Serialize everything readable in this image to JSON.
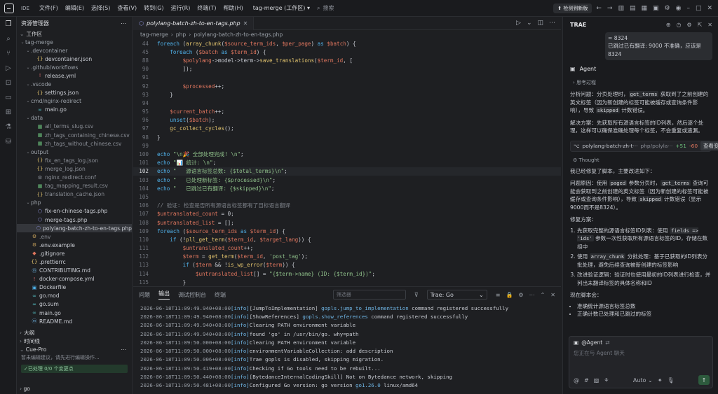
{
  "titlebar": {
    "ide_badge": "IDE",
    "menus": [
      "文件(F)",
      "编辑(E)",
      "选择(S)",
      "查看(V)",
      "转到(G)",
      "运行(R)",
      "终端(T)",
      "帮助(H)"
    ],
    "workspace": "tag-merge (工作区)",
    "search_placeholder": "搜索",
    "new_version": "检测到新版"
  },
  "explorer": {
    "title": "资源管理器",
    "section": "工作区",
    "tree": [
      {
        "label": "tag-merge",
        "depth": 0,
        "type": "folder",
        "open": true
      },
      {
        "label": ".devcontainer",
        "depth": 1,
        "type": "folder",
        "open": true
      },
      {
        "label": "devcontainer.json",
        "depth": 2,
        "type": "json"
      },
      {
        "label": ".github/workflows",
        "depth": 1,
        "type": "folder",
        "open": true
      },
      {
        "label": "release.yml",
        "depth": 2,
        "type": "yml"
      },
      {
        "label": ".vscode",
        "depth": 1,
        "type": "folder",
        "open": true
      },
      {
        "label": "settings.json",
        "depth": 2,
        "type": "json"
      },
      {
        "label": "cmd/nginx-redirect",
        "depth": 1,
        "type": "folder",
        "open": true
      },
      {
        "label": "main.go",
        "depth": 2,
        "type": "go"
      },
      {
        "label": "data",
        "depth": 1,
        "type": "folder",
        "open": true
      },
      {
        "label": "all_terms_slug.csv",
        "depth": 2,
        "type": "csv",
        "dim": true
      },
      {
        "label": "zh_tags_containing_chinese.csv",
        "depth": 2,
        "type": "csv",
        "dim": true
      },
      {
        "label": "zh_tags_without_chinese.csv",
        "depth": 2,
        "type": "csv",
        "dim": true
      },
      {
        "label": "output",
        "depth": 1,
        "type": "folder",
        "open": true
      },
      {
        "label": "fix_en_tags_log.json",
        "depth": 2,
        "type": "json",
        "dim": true
      },
      {
        "label": "merge_log.json",
        "depth": 2,
        "type": "json",
        "dim": true
      },
      {
        "label": "nginx_redirect.conf",
        "depth": 2,
        "type": "conf",
        "dim": true
      },
      {
        "label": "tag_mapping_result.csv",
        "depth": 2,
        "type": "csv",
        "dim": true
      },
      {
        "label": "translation_cache.json",
        "depth": 2,
        "type": "json",
        "dim": true
      },
      {
        "label": "php",
        "depth": 1,
        "type": "folder",
        "open": true
      },
      {
        "label": "fix-en-chinese-tags.php",
        "depth": 2,
        "type": "php"
      },
      {
        "label": "merge-tags.php",
        "depth": 2,
        "type": "php"
      },
      {
        "label": "polylang-batch-zh-to-en-tags.php",
        "depth": 2,
        "type": "php",
        "selected": true
      },
      {
        "label": ".env",
        "depth": 1,
        "type": "env",
        "dim": true
      },
      {
        "label": ".env.example",
        "depth": 1,
        "type": "env"
      },
      {
        "label": ".gitignore",
        "depth": 1,
        "type": "git"
      },
      {
        "label": ".prettierrc",
        "depth": 1,
        "type": "json"
      },
      {
        "label": "CONTRIBUTING.md",
        "depth": 1,
        "type": "md"
      },
      {
        "label": "docker-compose.yml",
        "depth": 1,
        "type": "yml"
      },
      {
        "label": "Dockerfile",
        "depth": 1,
        "type": "docker"
      },
      {
        "label": "go.mod",
        "depth": 1,
        "type": "go"
      },
      {
        "label": "go.sum",
        "depth": 1,
        "type": "go"
      },
      {
        "label": "main.go",
        "depth": 1,
        "type": "go"
      },
      {
        "label": "README.md",
        "depth": 1,
        "type": "md"
      }
    ],
    "outline": "大纲",
    "timeline": "时间线",
    "cue_title": "Cue-Pro",
    "cue_hint": "暂未编辑建议，请先进行编辑操作...",
    "cue_status": "已处理 0/0 个变更点",
    "go_section": "go"
  },
  "editor": {
    "tab_label": "polylang-batch-zh-to-en-tags.php",
    "breadcrumb": [
      "tag-merge",
      "php",
      "polylang-batch-zh-to-en-tags.php"
    ],
    "current_line": 102,
    "lines": [
      {
        "n": 44,
        "code": "foreach (array_chunk($source_term_ids, $per_page) as $batch) {"
      },
      {
        "n": 45,
        "code": "    foreach ($batch as $term_id) {"
      },
      {
        "n": 88,
        "code": "        $polylang->model->term->save_translations($term_id, ["
      },
      {
        "n": 90,
        "code": "        ]);"
      },
      {
        "n": 91,
        "code": ""
      },
      {
        "n": 92,
        "code": "        $processed++;"
      },
      {
        "n": 93,
        "code": "    }"
      },
      {
        "n": 94,
        "code": ""
      },
      {
        "n": 95,
        "code": "    $current_batch++;"
      },
      {
        "n": 96,
        "code": "    unset($batch);"
      },
      {
        "n": 97,
        "code": "    gc_collect_cycles();"
      },
      {
        "n": 98,
        "code": "}"
      },
      {
        "n": 99,
        "code": ""
      },
      {
        "n": 100,
        "code": "echo \"\\n🎉 全部处理完成! \\n\";"
      },
      {
        "n": 101,
        "code": "echo \"📊 统计: \\n\";"
      },
      {
        "n": 102,
        "code": "echo \"   源语言标签总数: {$total_terms}\\n\";"
      },
      {
        "n": 103,
        "code": "echo \"   已处理新标签: {$processed}\\n\";"
      },
      {
        "n": 104,
        "code": "echo \"   已跳过已有翻译: {$skipped}\\n\";"
      },
      {
        "n": 105,
        "code": ""
      },
      {
        "n": 106,
        "code": "// 验证: 检查是否所有源语言标签都有了目标语言翻译"
      },
      {
        "n": 107,
        "code": "$untranslated_count = 0;"
      },
      {
        "n": 108,
        "code": "$untranslated_list = [];"
      },
      {
        "n": 109,
        "code": "foreach ($source_term_ids as $term_id) {"
      },
      {
        "n": 110,
        "code": "    if (!pll_get_term($term_id, $target_lang)) {"
      },
      {
        "n": 111,
        "code": "        $untranslated_count++;"
      },
      {
        "n": 112,
        "code": "        $term = get_term($term_id, 'post_tag');"
      },
      {
        "n": 113,
        "code": "        if ($term && !is_wp_error($term)) {"
      },
      {
        "n": 114,
        "code": "            $untranslated_list[] = \"{$term->name} (ID: {$term_id})\";"
      },
      {
        "n": 115,
        "code": "        }"
      }
    ]
  },
  "panel": {
    "tabs": [
      "问题",
      "输出",
      "调试控制台",
      "终端"
    ],
    "active_tab": "输出",
    "filter_placeholder": "筛选器",
    "channel": "Trae: Go",
    "logs": [
      {
        "ts": "2026-06-18T11:09:49.940+08:00",
        "lv": "[info]",
        "msg": "[JumpToImplementation] ",
        "hl": "gopls.jump_to_implementation",
        "tail": " command registered successfully"
      },
      {
        "ts": "2026-06-18T11:09:49.940+08:00",
        "lv": "[info]",
        "msg": "[ShowReferences] ",
        "hl": "gopls.show_references",
        "tail": " command registered successfully"
      },
      {
        "ts": "2026-06-18T11:09:49.940+08:00",
        "lv": "[info]",
        "msg": "Clearing PATH environment variable",
        "hl": "",
        "tail": ""
      },
      {
        "ts": "2026-06-18T11:09:49.940+08:00",
        "lv": "[info]",
        "msg": "found 'go' in /usr/bin/go. why=path",
        "hl": "",
        "tail": ""
      },
      {
        "ts": "2026-06-18T11:09:50.000+08:00",
        "lv": "[info]",
        "msg": "Clearing PATH environment variable",
        "hl": "",
        "tail": ""
      },
      {
        "ts": "2026-06-18T11:09:50.000+08:00",
        "lv": "[info]",
        "msg": "environmentVariableCollection: add description",
        "hl": "",
        "tail": ""
      },
      {
        "ts": "2026-06-18T11:09:50.006+08:00",
        "lv": "[info]",
        "msg": "Trae gopls is disabled, skipping migration.",
        "hl": "",
        "tail": ""
      },
      {
        "ts": "2026-06-18T11:09:50.419+08:00",
        "lv": "[info]",
        "msg": "Checking if Go tools need to be rebuilt...",
        "hl": "",
        "tail": ""
      },
      {
        "ts": "2026-06-18T11:09:50.440+08:00",
        "lv": "[info]",
        "msg": "[BytedanceInternalCodingSkill] Not on Bytedance network, skipping",
        "hl": "",
        "tail": ""
      },
      {
        "ts": "2026-06-18T11:09:50.481+08:00",
        "lv": "[info]",
        "msg": "Configured Go version: go version ",
        "hl": "go1.26.0",
        "tail": " linux/amd64"
      }
    ]
  },
  "ai": {
    "title": "TRAE",
    "user_msg_line1": "= 8324",
    "user_msg_line2": "已跳过已有翻译: 9000 不准确，应该是 8324",
    "agent_name": "Agent",
    "think_label": "思考过程",
    "analysis_problem": "分析问题：分页处理时，get_terms 获取到了之前创建的英文标签（因为新创建的标签可能被缓存或查询条件影响），导致 skipped 计数错误。",
    "analysis_solution": "解决方案：先获取所有源语言标签的ID列表，然后逐个处理，这样可以确保准确处理每个标签，不会重复或遗漏。",
    "chip_file": "polylang-batch-zh-t···",
    "chip_path": "php/polyla···",
    "chip_added": "+51",
    "chip_removed": "-60",
    "chip_review": "查看变更",
    "thought_label": "Thought",
    "fixed_intro": "我已经修复了脚本，主要改进如下：",
    "root_cause": "问题原因：使用 paged 参数分页时，get_terms 查询可能会获取到之前创建的英文标签（因为新创建的标签可能被缓存或查询条件影响），导致 skipped 计数错误（显示9000而不是8324）。",
    "plan_title": "修复方案：",
    "plan": [
      "先获取完整的源语言标签ID列表：使用 fields => 'ids' 参数一次性获取所有源语言标签的ID，存储在数组中",
      "使用 array_chunk 分批处理：基于已获取的ID列表分批处理，避免后续查询被新创建的标签影响",
      "改进验证逻辑：验证时也使用最初的ID列表进行检查，并列出未翻译标签的具体名称和ID"
    ],
    "now_title": "现在脚本会：",
    "now_items": [
      "准确统计源语言标签总数",
      "正确计数已处理和已跳过的标签"
    ],
    "input_mention": "@Agent",
    "input_placeholder": "您正在与 Agent 聊天",
    "input_mode": "Auto"
  }
}
